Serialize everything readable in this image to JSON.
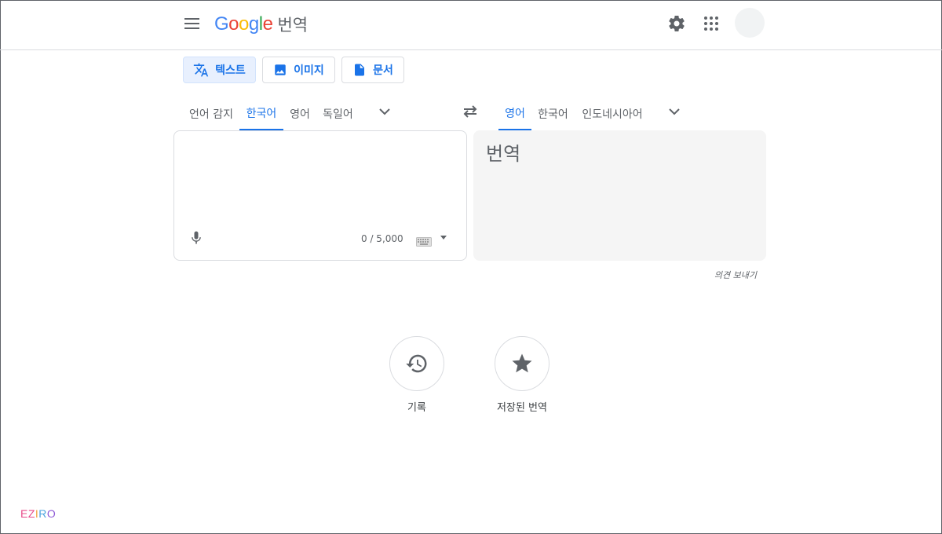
{
  "header": {
    "logo_letters": [
      {
        "ch": "G",
        "color": "#4285f4"
      },
      {
        "ch": "o",
        "color": "#ea4335"
      },
      {
        "ch": "o",
        "color": "#fbbc05"
      },
      {
        "ch": "g",
        "color": "#4285f4"
      },
      {
        "ch": "l",
        "color": "#34a853"
      },
      {
        "ch": "e",
        "color": "#ea4335"
      }
    ],
    "product_name": "번역",
    "icons": [
      "menu-icon",
      "gear-icon",
      "apps-grid-icon",
      "avatar"
    ]
  },
  "modes": [
    {
      "label": "텍스트",
      "icon": "translate-icon",
      "active": true
    },
    {
      "label": "이미지",
      "icon": "image-icon",
      "active": false
    },
    {
      "label": "문서",
      "icon": "document-icon",
      "active": false
    }
  ],
  "source_languages": [
    {
      "label": "언어 감지",
      "selected": false
    },
    {
      "label": "한국어",
      "selected": true
    },
    {
      "label": "영어",
      "selected": false
    },
    {
      "label": "독일어",
      "selected": false
    }
  ],
  "target_languages": [
    {
      "label": "영어",
      "selected": true
    },
    {
      "label": "한국어",
      "selected": false
    },
    {
      "label": "인도네시아어",
      "selected": false
    }
  ],
  "source": {
    "value": "",
    "char_count": "0 / 5,000"
  },
  "target": {
    "placeholder_text": "번역"
  },
  "feedback_label": "의견 보내기",
  "actions": [
    {
      "label": "기록",
      "icon": "history-icon"
    },
    {
      "label": "저장된 번역",
      "icon": "star-icon"
    }
  ],
  "watermark": {
    "letters": [
      {
        "ch": "E",
        "color": "#e84a8a"
      },
      {
        "ch": "Z",
        "color": "#e84a8a"
      },
      {
        "ch": "I",
        "color": "#f0a33c"
      },
      {
        "ch": "R",
        "color": "#4aa3df"
      },
      {
        "ch": "O",
        "color": "#8e5ad6"
      }
    ]
  },
  "colors": {
    "accent": "#1a73e8",
    "active_mode_bg": "#e8f0fe",
    "target_panel_bg": "#f5f5f5"
  }
}
